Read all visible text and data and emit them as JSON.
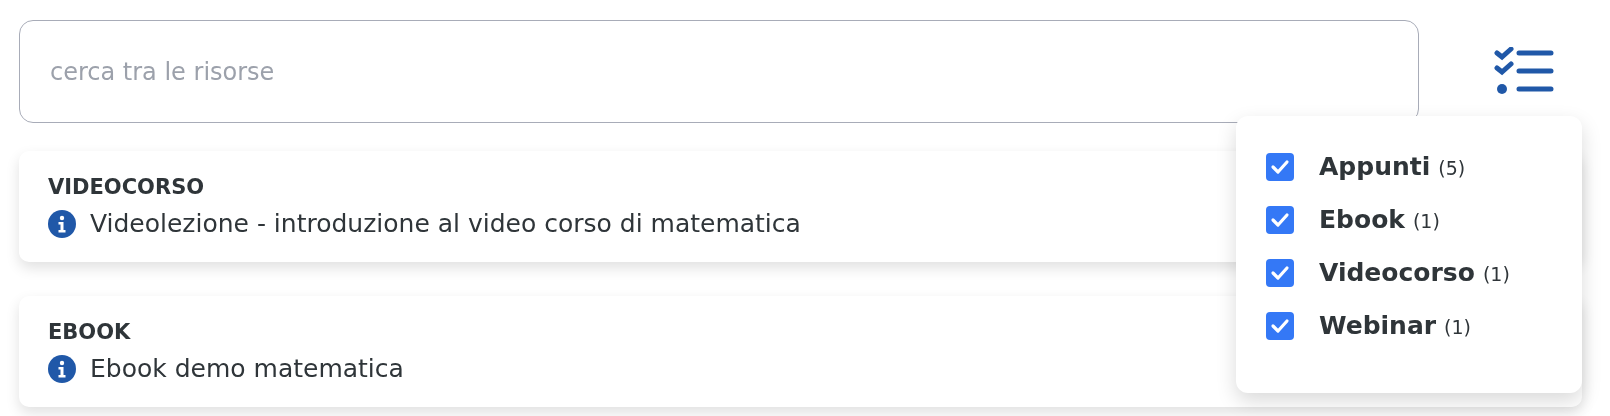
{
  "search": {
    "placeholder": "cerca tra le risorse"
  },
  "resources": [
    {
      "type": "VIDEOCORSO",
      "title": "Videolezione - introduzione al video corso di matematica"
    },
    {
      "type": "EBOOK",
      "title": "Ebook demo matematica"
    }
  ],
  "filter_menu": {
    "open": true,
    "items": [
      {
        "name": "Appunti",
        "count": "(5)",
        "checked": true
      },
      {
        "name": "Ebook",
        "count": "(1)",
        "checked": true
      },
      {
        "name": "Videocorso",
        "count": "(1)",
        "checked": true
      },
      {
        "name": "Webinar",
        "count": "(1)",
        "checked": true
      }
    ]
  }
}
